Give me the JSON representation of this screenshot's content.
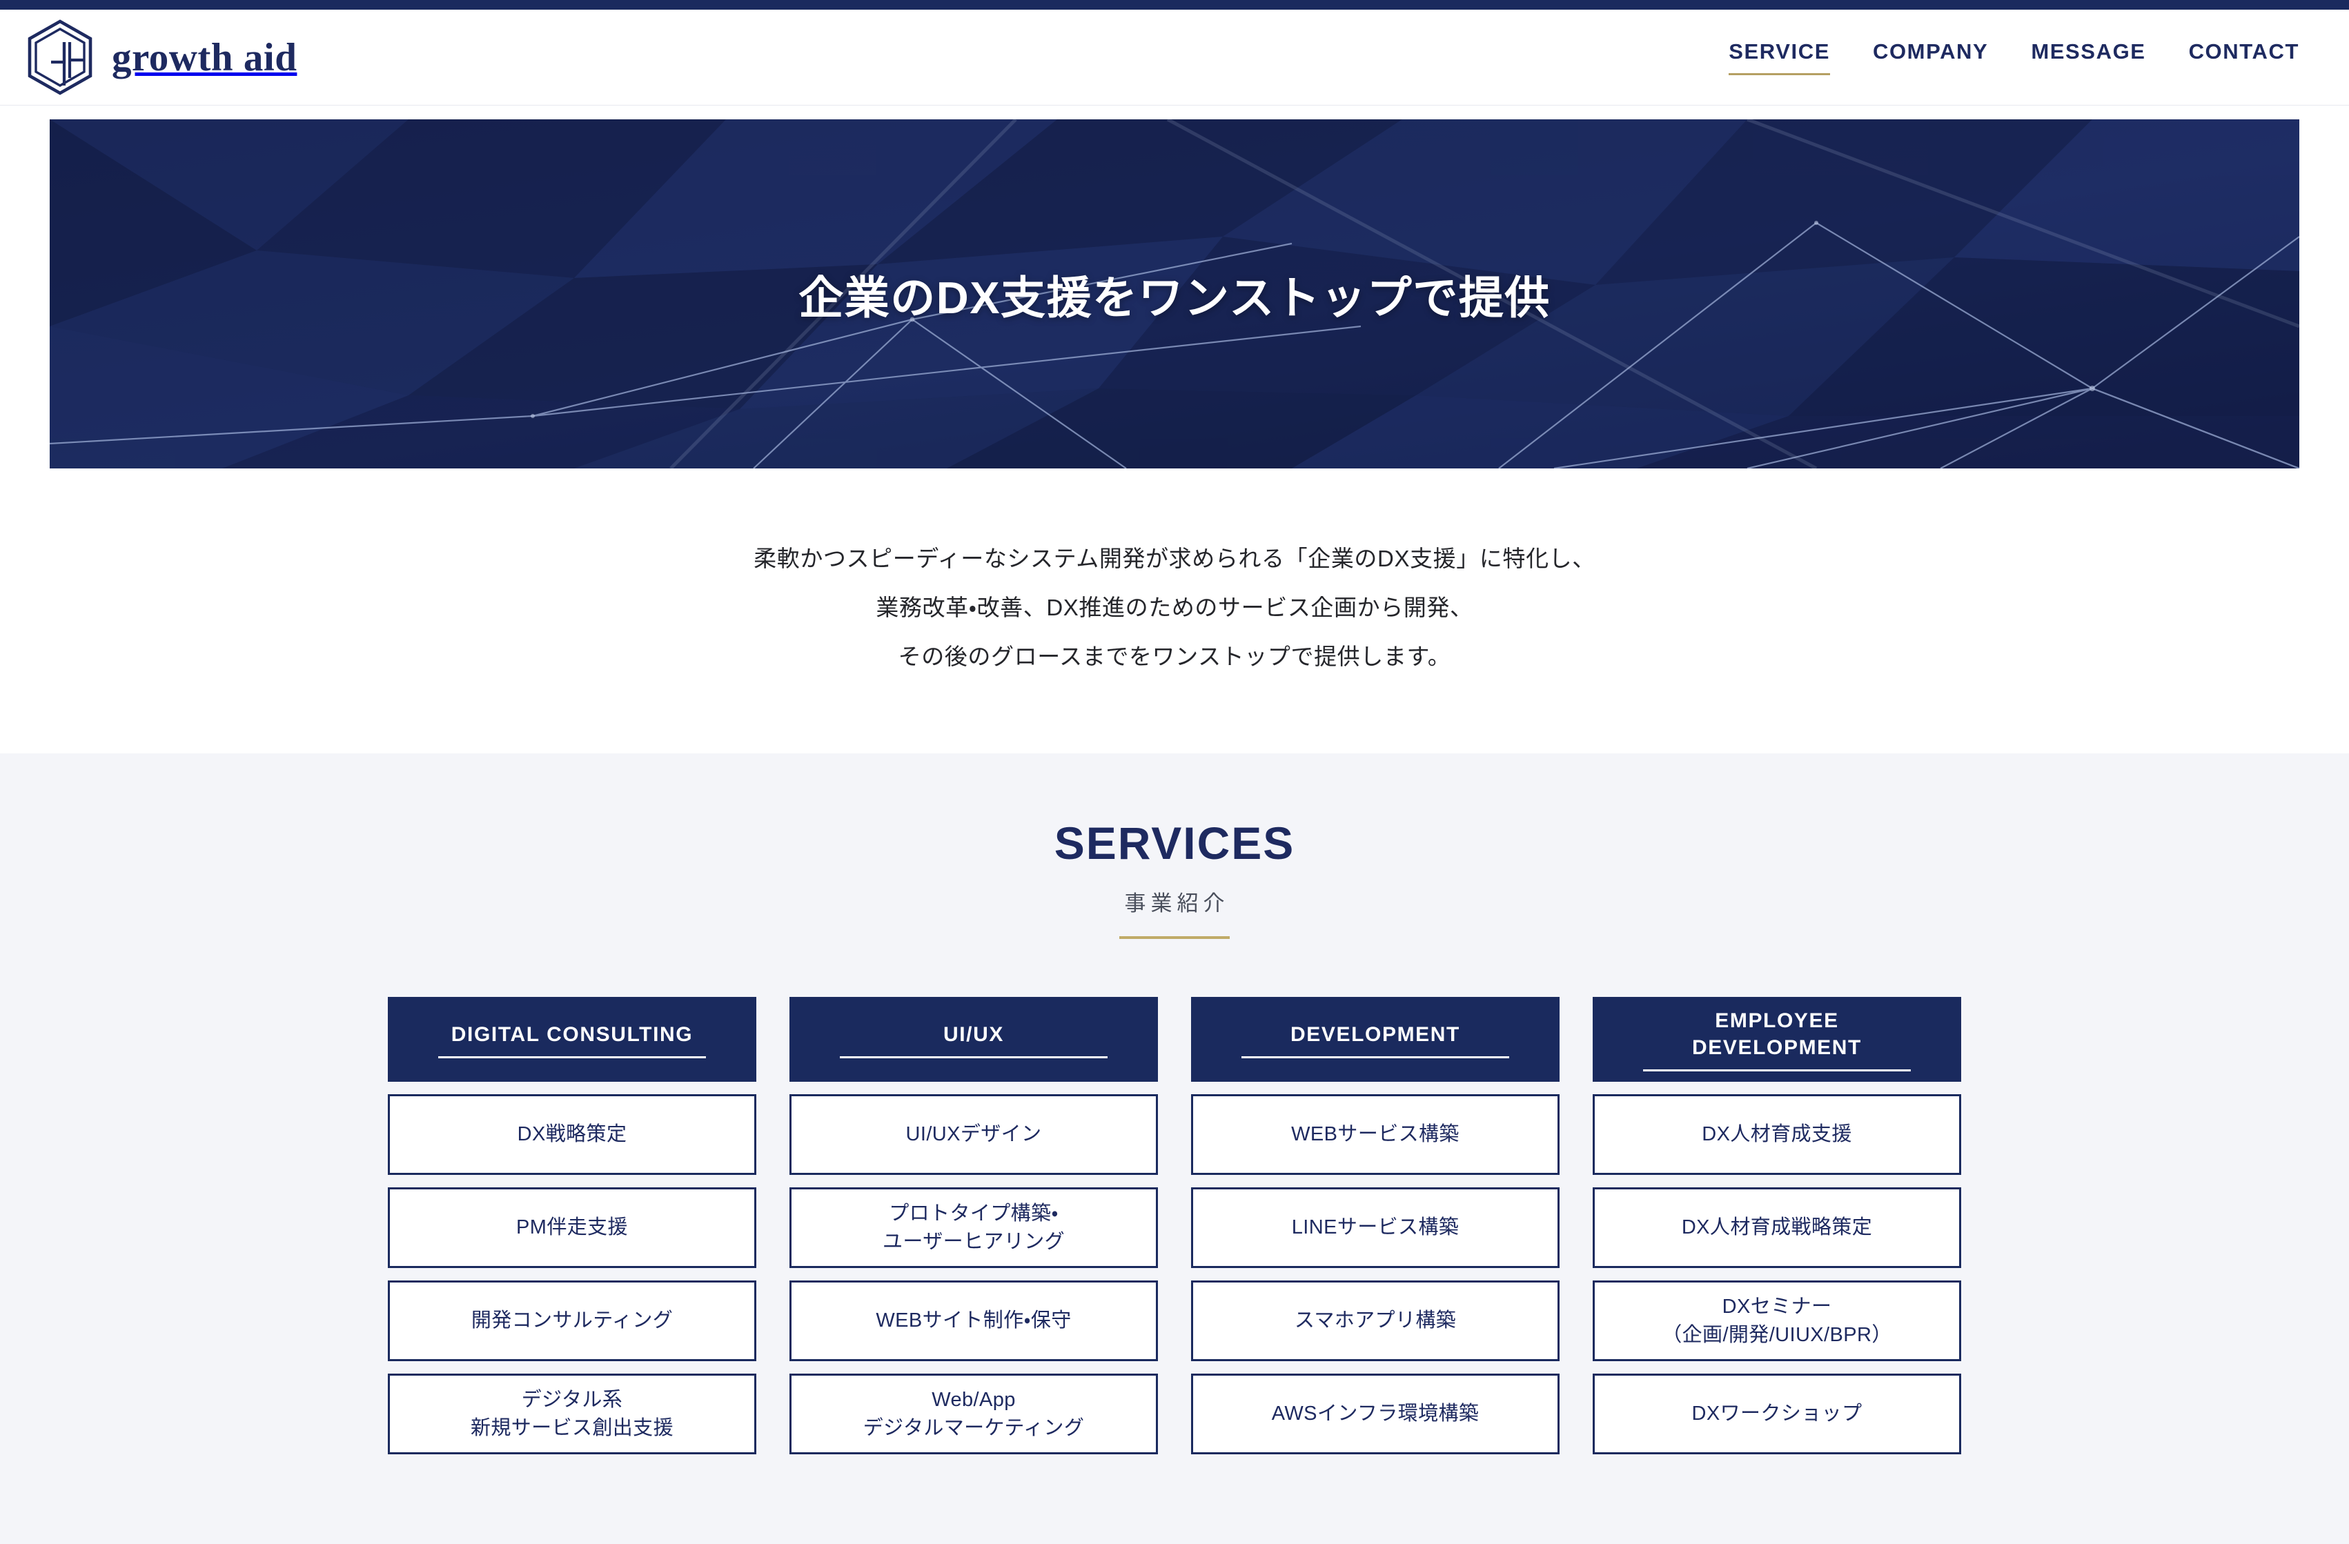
{
  "theme": {
    "navy": "#1a2a5e",
    "navy_text": "#1e2a60",
    "gold": "#c0ab68",
    "nav_underline_gold": "#b59f62",
    "section_bg": "#f4f5f9",
    "white": "#ffffff",
    "body_text": "#25262b"
  },
  "header": {
    "brand_name": "growth aid",
    "logo_icon": "hexagon-ga-monogram-icon",
    "nav": [
      {
        "label": "SERVICE",
        "active": true
      },
      {
        "label": "COMPANY",
        "active": false
      },
      {
        "label": "MESSAGE",
        "active": false
      },
      {
        "label": "CONTACT",
        "active": false
      }
    ]
  },
  "hero": {
    "title": "企業のDX支援をワンストップで提供",
    "background_style": "low-poly-navy-network"
  },
  "intro": {
    "lines": [
      "柔軟かつスピーディーなシステム開発が求められる「企業のDX支援」に特化し、",
      "業務改革・改善、DX推進のためのサービス企画から開発、",
      "その後のグロースまでをワンストップで提供します。"
    ]
  },
  "services": {
    "title": "SERVICES",
    "subtitle": "事業紹介",
    "columns": [
      {
        "header": "DIGITAL CONSULTING",
        "items": [
          "DX戦略策定",
          "PM伴走支援",
          "開発コンサルティング",
          "デジタル系\n新規サービス創出支援"
        ]
      },
      {
        "header": "UI/UX",
        "items": [
          "UI/UXデザイン",
          "プロトタイプ構築・\nユーザーヒアリング",
          "WEBサイト制作・保守",
          "Web/App\nデジタルマーケティング"
        ]
      },
      {
        "header": "DEVELOPMENT",
        "items": [
          "WEBサービス構築",
          "LINEサービス構築",
          "スマホアプリ構築",
          "AWSインフラ環境構築"
        ]
      },
      {
        "header": "EMPLOYEE\nDEVELOPMENT",
        "items": [
          "DX人材育成支援",
          "DX人材育成戦略策定",
          "DXセミナー\n（企画/開発/UIUX/BPR）",
          "DXワークショップ"
        ]
      }
    ]
  }
}
